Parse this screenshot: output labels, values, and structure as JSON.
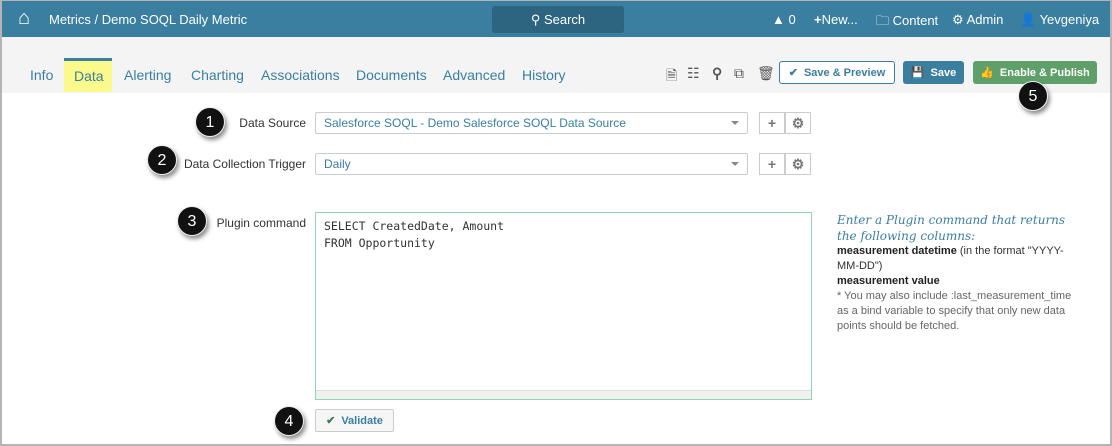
{
  "header": {
    "breadcrumb_root": "Metrics",
    "breadcrumb_sep": " / ",
    "breadcrumb_page": "Demo SOQL Daily Metric",
    "search_label": "Search",
    "alerts_count": "0",
    "new_label": "New...",
    "content_label": "Content",
    "admin_label": "Admin",
    "user_name": "Yevgeniya",
    "color": "#3a7fa0"
  },
  "tabs": [
    {
      "label": "Info"
    },
    {
      "label": "Data",
      "active": true
    },
    {
      "label": "Alerting"
    },
    {
      "label": "Charting"
    },
    {
      "label": "Associations"
    },
    {
      "label": "Documents"
    },
    {
      "label": "Advanced"
    },
    {
      "label": "History"
    }
  ],
  "toolbar": {
    "save_preview": "Save & Preview",
    "save": "Save",
    "enable_publish": "Enable & Publish"
  },
  "form": {
    "data_source": {
      "label": "Data Source",
      "value": "Salesforce SOQL - Demo Salesforce SOQL Data Source"
    },
    "trigger": {
      "label": "Data Collection Trigger",
      "value": "Daily"
    },
    "plugin": {
      "label": "Plugin command",
      "line1": "SELECT CreatedDate, Amount",
      "line2": "FROM Opportunity"
    },
    "validate": "Validate"
  },
  "help": {
    "intro": "Enter a Plugin command that returns the following columns:",
    "col1": "measurement datetime",
    "col1_note": " (in the format \"YYYY-MM-DD\")",
    "col2": "measurement value",
    "note": "* You may also include :last_measurement_time as a bind variable to specify that only new data points should be fetched."
  },
  "badges": [
    "1",
    "2",
    "3",
    "4",
    "5"
  ]
}
